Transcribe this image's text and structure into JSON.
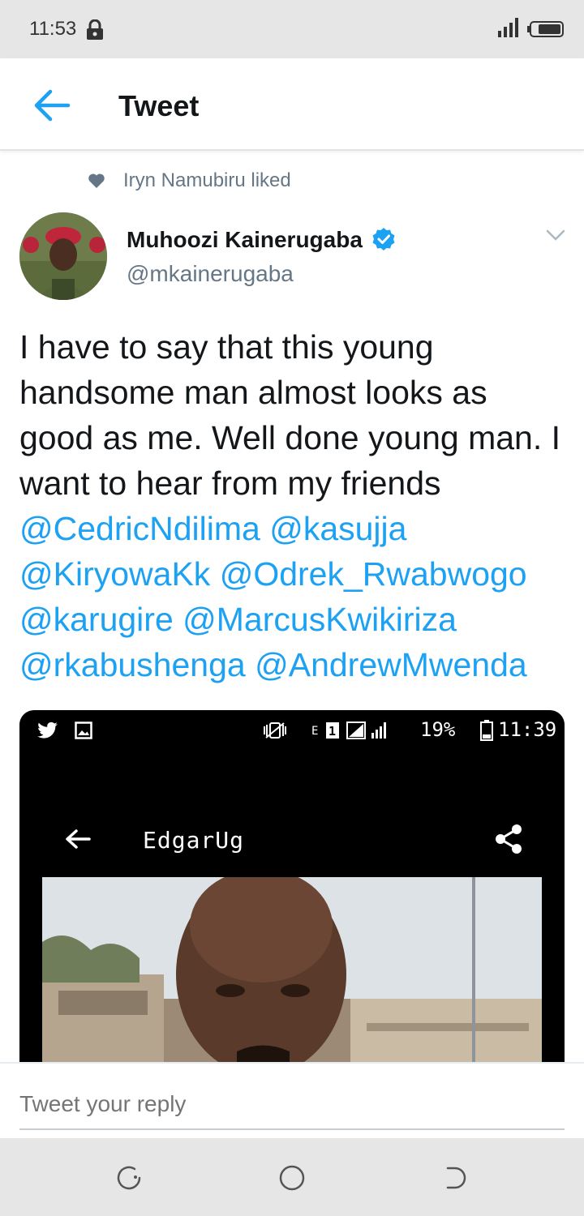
{
  "status_bar": {
    "time": "11:53",
    "icons": [
      "lock-icon",
      "signal-icon",
      "battery-icon"
    ]
  },
  "header": {
    "title": "Tweet",
    "back_icon": "arrow-left-icon",
    "accent_color": "#1da1f2"
  },
  "social_context": {
    "text": "Iryn Namubiru liked",
    "icon": "heart-icon"
  },
  "tweet": {
    "author_name": "Muhoozi Kainerugaba",
    "author_handle": "@mkainerugaba",
    "verified": true,
    "text_plain": "I have to say that this young handsome man almost looks as good as me. Well done young man. I want to hear from my friends",
    "mentions": [
      "@CedricNdilima",
      "@kasujja",
      "@KiryowaKk",
      "@Odrek_Rwabwogo",
      "@karugire",
      "@MarcusKwikiriza",
      "@rkabushenga",
      "@AndrewMwenda"
    ],
    "media": {
      "status_battery": "19%",
      "status_time": "11:39",
      "screen_title": "EdgarUg"
    }
  },
  "reply": {
    "placeholder": "Tweet your reply"
  },
  "nav": {
    "icons": [
      "recent-apps-icon",
      "home-icon",
      "back-nav-icon"
    ]
  }
}
